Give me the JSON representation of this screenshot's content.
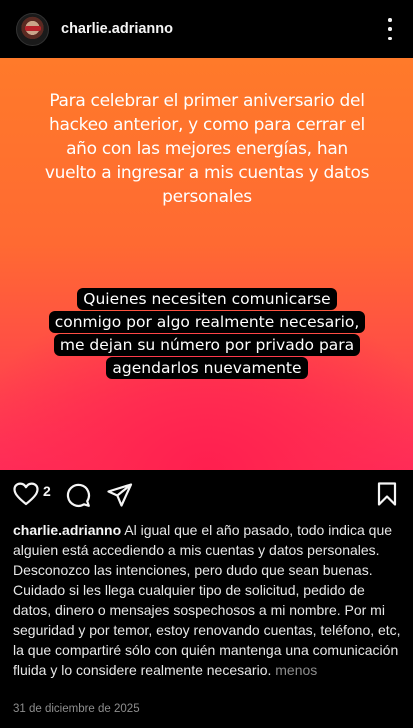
{
  "header": {
    "username": "charlie.adrianno",
    "avatar": "profile-avatar",
    "more_icon": "more-vertical-icon"
  },
  "post": {
    "text_main": "Para celebrar el primer aniversario del hackeo anterior, y como para cerrar el año con las mejores energías, han vuelto a ingresar a mis cuentas y datos personales",
    "text_highlight": "Quienes necesiten comunicarse conmigo por algo realmente necesario, me dejan su número por privado para agendarlos nuevamente",
    "colors": {
      "top": "#ff7a2a",
      "bottom": "#ff2c5a"
    }
  },
  "actions": {
    "like_icon": "heart-icon",
    "like_count": "2",
    "comment_icon": "comment-icon",
    "share_icon": "send-icon",
    "save_icon": "bookmark-icon"
  },
  "caption": {
    "username": "charlie.adrianno",
    "text": "Al igual que el año pasado, todo indica que alguien está accediendo a mis cuentas y datos personales. Desconozco las intenciones, pero dudo que sean buenas. Cuidado si les llega cualquier tipo de solicitud,  pedido de datos, dinero o mensajes sospechosos  a mi nombre. Por mi seguridad y por temor, estoy renovando cuentas, teléfono, etc, la que compartiré sólo con quién mantenga una comunicación fluida y lo considere realmente necesario.",
    "less_label": "menos"
  },
  "date": "31 de diciembre de 2025"
}
